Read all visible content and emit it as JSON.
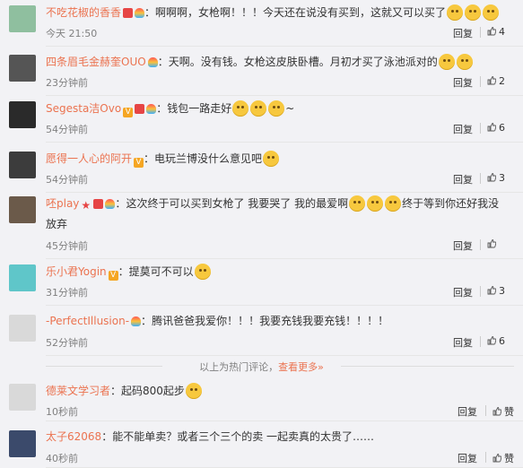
{
  "comments": [
    {
      "name": "不吃花椒的香香",
      "text": "啊啊啊，女枪啊！！！今天还在说没有买到，这就又可以买了",
      "time": "今天 21:50",
      "reply": "回复",
      "likes": "4",
      "avatar_color": "#8fbf9f",
      "badges": [
        "vip-crown-icon",
        "bulb-icon"
      ],
      "emojis": 3
    },
    {
      "name": "四条眉毛金赫奎OUO",
      "text": "天啊。没有钱。女枪这皮肤卧槽。月初才买了泳池派对的",
      "time": "23分钟前",
      "reply": "回复",
      "likes": "2",
      "avatar_color": "#555555",
      "badges": [
        "bulb-icon"
      ],
      "emojis": 2
    },
    {
      "name": "Segesta洁Ovo",
      "text": "钱包一路走好",
      "text_after": "~",
      "time": "54分钟前",
      "reply": "回复",
      "likes": "6",
      "avatar_color": "#2a2a2a",
      "badges": [
        "v-icon",
        "vip-crown-icon",
        "bulb-icon"
      ],
      "emojis": 3
    },
    {
      "name": "愿得一人心的阿开",
      "text": "电玩兰博没什么意见吧",
      "time": "54分钟前",
      "reply": "回复",
      "likes": "3",
      "avatar_color": "#3c3c3c",
      "badges": [
        "v-icon"
      ],
      "emojis": 1
    },
    {
      "name": "呸play",
      "text": "这次终于可以买到女枪了 我要哭了 我的最爱啊",
      "text_after": "终于等到你还好我没",
      "text_line2": "放弃",
      "time": "45分钟前",
      "reply": "回复",
      "likes": "",
      "avatar_color": "#6b5a4a",
      "badges": [
        "star-icon",
        "vip-crown-icon",
        "bulb-icon"
      ],
      "emojis": 3
    },
    {
      "name": "乐小君Yogin",
      "text": "提莫可不可以",
      "time": "31分钟前",
      "reply": "回复",
      "likes": "3",
      "avatar_color": "#5fc6c9",
      "badges": [
        "v-icon"
      ],
      "emojis": 1
    },
    {
      "name": "-PerfectIllusion-",
      "text": "腾讯爸爸我爱你！！！我要充钱我要充钱！！！！",
      "time": "52分钟前",
      "reply": "回复",
      "likes": "6",
      "avatar_color": "#d9d9d9",
      "badges": [
        "bulb-icon"
      ],
      "emojis": 0
    }
  ],
  "hot_divider": {
    "text": "以上为热门评论，",
    "link": "查看更多»"
  },
  "latest": [
    {
      "name": "德莱文学习者",
      "text": "起码800起步",
      "time": "10秒前",
      "reply": "回复",
      "likes": "赞",
      "avatar_color": "#d9d9d9",
      "emojis": 1
    },
    {
      "name": "太子62068",
      "text": "能不能单卖？或者三个三个的卖 一起卖真的太贵了……",
      "time": "40秒前",
      "reply": "回复",
      "likes": "赞",
      "avatar_color": "#3b4a6b",
      "emojis": 0
    }
  ],
  "colors": {
    "name": "#eb7350",
    "muted": "#808080",
    "background": "#f2f2f5"
  }
}
